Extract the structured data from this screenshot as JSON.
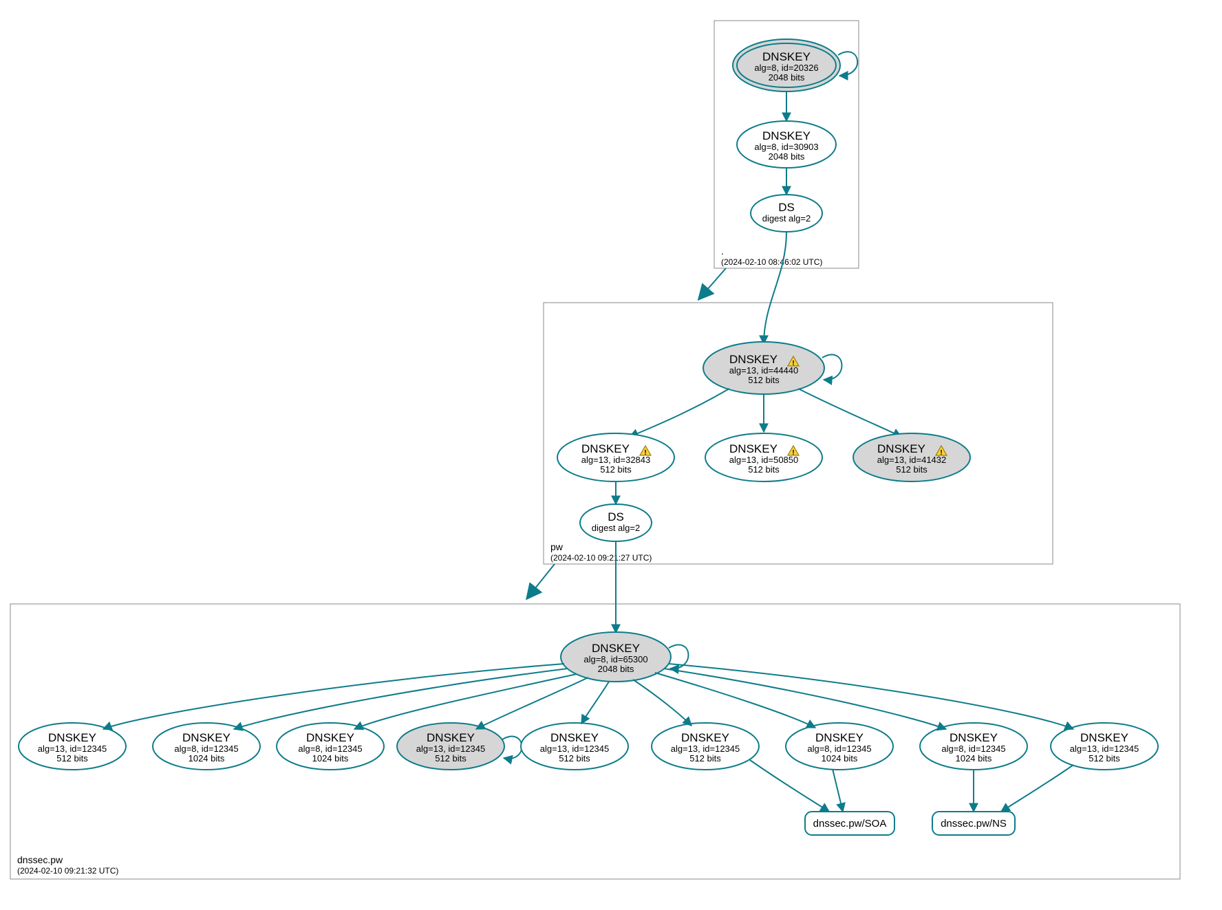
{
  "zones": {
    "root": {
      "label": ".",
      "timestamp": "(2024-02-10 08:46:02 UTC)"
    },
    "pw": {
      "label": "pw",
      "timestamp": "(2024-02-10 09:21:27 UTC)"
    },
    "dnssec_pw": {
      "label": "dnssec.pw",
      "timestamp": "(2024-02-10 09:21:32 UTC)"
    }
  },
  "nodes": {
    "root_ksk": {
      "title": "DNSKEY",
      "l1": "alg=8, id=20326",
      "l2": "2048 bits"
    },
    "root_zsk": {
      "title": "DNSKEY",
      "l1": "alg=8, id=30903",
      "l2": "2048 bits"
    },
    "root_ds": {
      "title": "DS",
      "l1": "digest alg=2"
    },
    "pw_ksk": {
      "title": "DNSKEY",
      "l1": "alg=13, id=44440",
      "l2": "512 bits",
      "warn": true
    },
    "pw_k1": {
      "title": "DNSKEY",
      "l1": "alg=13, id=32843",
      "l2": "512 bits",
      "warn": true
    },
    "pw_k2": {
      "title": "DNSKEY",
      "l1": "alg=13, id=50850",
      "l2": "512 bits",
      "warn": true
    },
    "pw_k3": {
      "title": "DNSKEY",
      "l1": "alg=13, id=41432",
      "l2": "512 bits",
      "warn": true
    },
    "pw_ds": {
      "title": "DS",
      "l1": "digest alg=2"
    },
    "dn_ksk": {
      "title": "DNSKEY",
      "l1": "alg=8, id=65300",
      "l2": "2048 bits"
    },
    "dn_k0": {
      "title": "DNSKEY",
      "l1": "alg=13, id=12345",
      "l2": "512 bits"
    },
    "dn_k1": {
      "title": "DNSKEY",
      "l1": "alg=8, id=12345",
      "l2": "1024 bits"
    },
    "dn_k2": {
      "title": "DNSKEY",
      "l1": "alg=8, id=12345",
      "l2": "1024 bits"
    },
    "dn_k3": {
      "title": "DNSKEY",
      "l1": "alg=13, id=12345",
      "l2": "512 bits"
    },
    "dn_k4": {
      "title": "DNSKEY",
      "l1": "alg=13, id=12345",
      "l2": "512 bits"
    },
    "dn_k5": {
      "title": "DNSKEY",
      "l1": "alg=13, id=12345",
      "l2": "512 bits"
    },
    "dn_k6": {
      "title": "DNSKEY",
      "l1": "alg=8, id=12345",
      "l2": "1024 bits"
    },
    "dn_k7": {
      "title": "DNSKEY",
      "l1": "alg=8, id=12345",
      "l2": "1024 bits"
    },
    "dn_k8": {
      "title": "DNSKEY",
      "l1": "alg=13, id=12345",
      "l2": "512 bits"
    },
    "rr_soa": {
      "title": "dnssec.pw/SOA"
    },
    "rr_ns": {
      "title": "dnssec.pw/NS"
    }
  }
}
